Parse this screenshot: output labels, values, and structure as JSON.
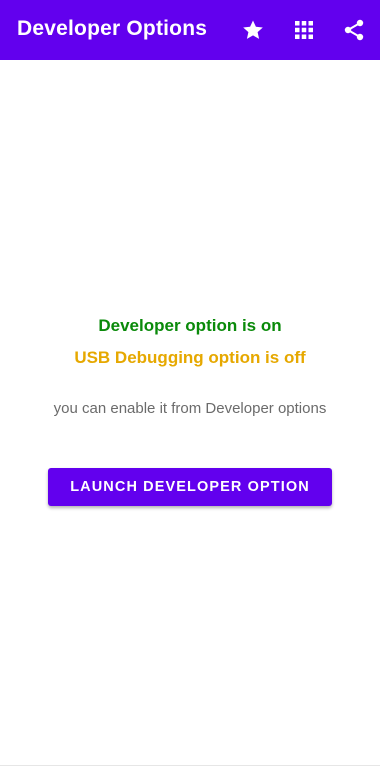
{
  "app_bar": {
    "title": "Developer Options",
    "background_color": "#6200ee",
    "actions": [
      {
        "icon": "star-icon"
      },
      {
        "icon": "apps-grid-icon"
      },
      {
        "icon": "share-icon"
      }
    ]
  },
  "status": {
    "developer_option": "Developer option is on",
    "developer_option_color": "#0a8a0a",
    "usb_debugging": "USB Debugging option is off",
    "usb_debugging_color": "#e6a800"
  },
  "hint": "you can enable it from Developer options",
  "launch_button": {
    "label": "LAUNCH DEVELOPER OPTION",
    "color": "#6200ee"
  }
}
